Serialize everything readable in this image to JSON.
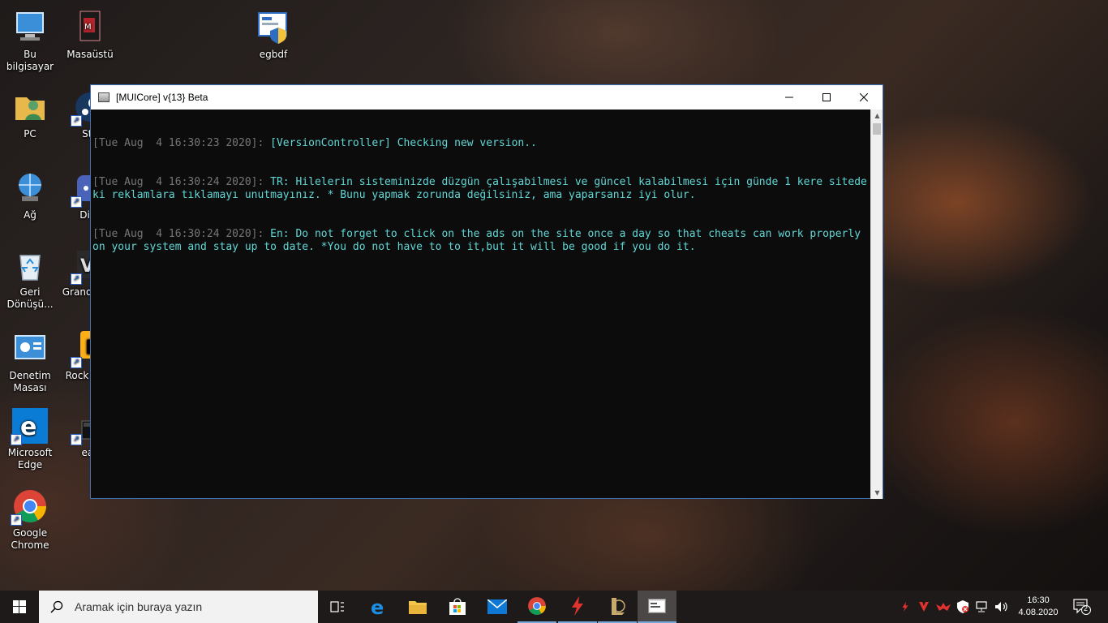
{
  "desktop": {
    "icons": [
      {
        "label": "Bu bilgisayar",
        "icon": "computer-icon"
      },
      {
        "label": "Masaüstü",
        "icon": "folder-icon"
      },
      {
        "label": "egbdf",
        "icon": "installer-shield-icon"
      },
      {
        "label": "PC",
        "icon": "user-folder-icon"
      },
      {
        "label": "Ste",
        "icon": "steam-icon"
      },
      {
        "label": "Ağ",
        "icon": "network-icon"
      },
      {
        "label": "Disc",
        "icon": "discord-icon"
      },
      {
        "label": "Geri Dönüşü...",
        "icon": "recycle-bin-icon"
      },
      {
        "label": "Grand Auto",
        "icon": "gta-icon"
      },
      {
        "label": "Denetim Masası",
        "icon": "control-panel-icon"
      },
      {
        "label": "Rock Gam",
        "icon": "rockstar-icon"
      },
      {
        "label": "Microsoft Edge",
        "icon": "edge-icon"
      },
      {
        "label": "eas",
        "icon": "app-icon"
      },
      {
        "label": "Google Chrome",
        "icon": "chrome-icon"
      }
    ]
  },
  "window": {
    "title": "[MUICore] v{13} Beta",
    "minimize": "minimize-icon",
    "maximize": "maximize-icon",
    "close": "close-icon",
    "lines": [
      {
        "ts": "[Tue Aug  4 16:30:23 2020]: ",
        "msg": "[VersionController] Checking new version.."
      },
      {
        "ts": "[Tue Aug  4 16:30:24 2020]: ",
        "msg": "TR: Hilelerin sisteminizde düzgün çalışabilmesi ve güncel kalabilmesi için günde 1 kere sitedeki reklamlara tıklamayı unutmayınız. * Bunu yapmak zorunda değilsiniz, ama yaparsanız iyi olur."
      },
      {
        "ts": "[Tue Aug  4 16:30:24 2020]: ",
        "msg": "En: Do not forget to click on the ads on the site once a day so that cheats can work properly on your system and stay up to date. *You do not have to to it,but it will be good if you do it."
      }
    ]
  },
  "taskbar": {
    "search_placeholder": "Aramak için buraya yazın",
    "time": "16:30",
    "date": "4.08.2020",
    "notifications": "2",
    "colors": {
      "accent": "#0078d7",
      "console_text": "#61d6d6",
      "timestamp": "#767676"
    }
  }
}
